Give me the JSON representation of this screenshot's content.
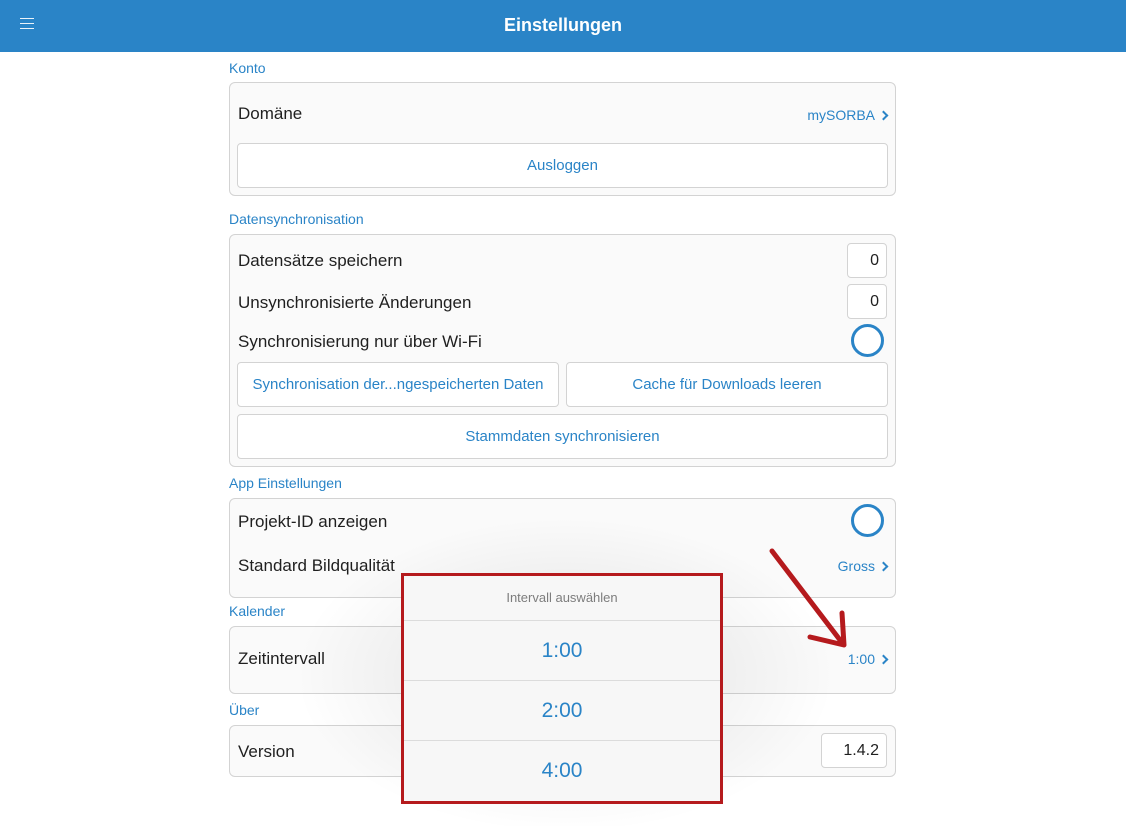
{
  "header": {
    "title": "Einstellungen",
    "menu_icon": "hamburger-menu-icon"
  },
  "konto": {
    "label": "Konto",
    "domain_label": "Domäne",
    "domain_value": "mySORBA",
    "logout_button": "Ausloggen"
  },
  "sync": {
    "label": "Datensynchronisation",
    "saved_records_label": "Datensätze speichern",
    "saved_records_value": "0",
    "unsynced_label": "Unsynchronisierte Änderungen",
    "unsynced_value": "0",
    "wifi_only_label": "Synchronisierung nur über Wi-Fi",
    "sync_saved_button": "Synchronisation der...ngespeicherten Daten",
    "clear_cache_button": "Cache für Downloads leeren",
    "sync_master_button": "Stammdaten synchronisieren"
  },
  "app": {
    "label": "App Einstellungen",
    "project_id_label": "Projekt-ID anzeigen",
    "image_quality_label": "Standard Bildqualität",
    "image_quality_value": "Gross"
  },
  "calendar": {
    "label": "Kalender",
    "interval_label": "Zeitintervall",
    "interval_value": "1:00"
  },
  "about": {
    "label": "Über",
    "version_label": "Version",
    "version_value": "1.4.2"
  },
  "picker": {
    "title": "Intervall auswählen",
    "options": [
      "1:00",
      "2:00",
      "4:00"
    ]
  },
  "colors": {
    "accent": "#2a84c7",
    "annotation_red": "#b51a1d"
  }
}
